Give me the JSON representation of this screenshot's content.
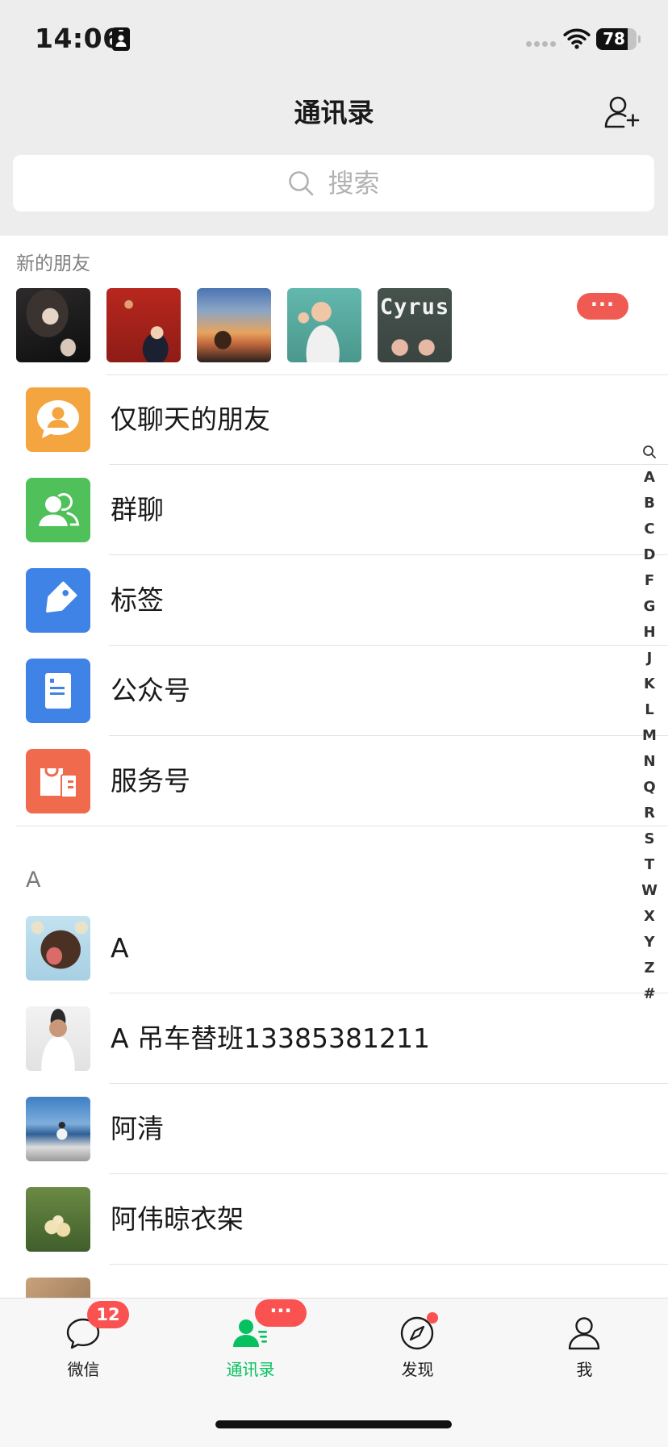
{
  "status_bar": {
    "time": "14:06",
    "battery_level": "78",
    "icons": {
      "focus": "contact-card-icon",
      "signal": "signal-dots-icon",
      "wifi": "wifi-icon",
      "battery": "battery-icon"
    }
  },
  "header": {
    "title": "通讯录",
    "add_icon": "add-contact-icon"
  },
  "search": {
    "placeholder": "搜索",
    "icon": "search-icon"
  },
  "new_friends": {
    "label": "新的朋友",
    "more_badge": "···",
    "avatars": [
      {
        "icon": "avatar-photo"
      },
      {
        "icon": "avatar-photo"
      },
      {
        "icon": "avatar-photo"
      },
      {
        "icon": "avatar-photo"
      },
      {
        "icon": "avatar-photo",
        "text": "Cyrus"
      }
    ]
  },
  "entries": [
    {
      "label": "仅聊天的朋友",
      "icon": "chat-only-friends-icon",
      "color": "#f4a540"
    },
    {
      "label": "群聊",
      "icon": "group-chat-icon",
      "color": "#4fc05a"
    },
    {
      "label": "标签",
      "icon": "tag-icon",
      "color": "#3f83e6"
    },
    {
      "label": "公众号",
      "icon": "official-account-icon",
      "color": "#3f83e6"
    },
    {
      "label": "服务号",
      "icon": "service-account-icon",
      "color": "#f06b4d"
    }
  ],
  "sections": [
    {
      "letter": "A",
      "contacts": [
        {
          "name": "A"
        },
        {
          "name": "A 吊车替班13385381211"
        },
        {
          "name": "阿清"
        },
        {
          "name": "阿伟晾衣架"
        }
      ]
    }
  ],
  "index": [
    "A",
    "B",
    "C",
    "D",
    "F",
    "G",
    "H",
    "J",
    "K",
    "L",
    "M",
    "N",
    "Q",
    "R",
    "S",
    "T",
    "W",
    "X",
    "Y",
    "Z",
    "#"
  ],
  "tabbar": {
    "items": [
      {
        "label": "微信",
        "icon": "chat-bubble-icon",
        "badge": "12"
      },
      {
        "label": "通讯录",
        "icon": "contacts-icon",
        "badge": "···",
        "active": true
      },
      {
        "label": "发现",
        "icon": "compass-icon",
        "dot": true
      },
      {
        "label": "我",
        "icon": "profile-icon"
      }
    ]
  },
  "colors": {
    "accent": "#07c160",
    "badge": "#fa5151",
    "background": "#ededed",
    "divider": "#e3e3e3",
    "text": "#191919",
    "secondary_text": "#7f7f7f"
  }
}
